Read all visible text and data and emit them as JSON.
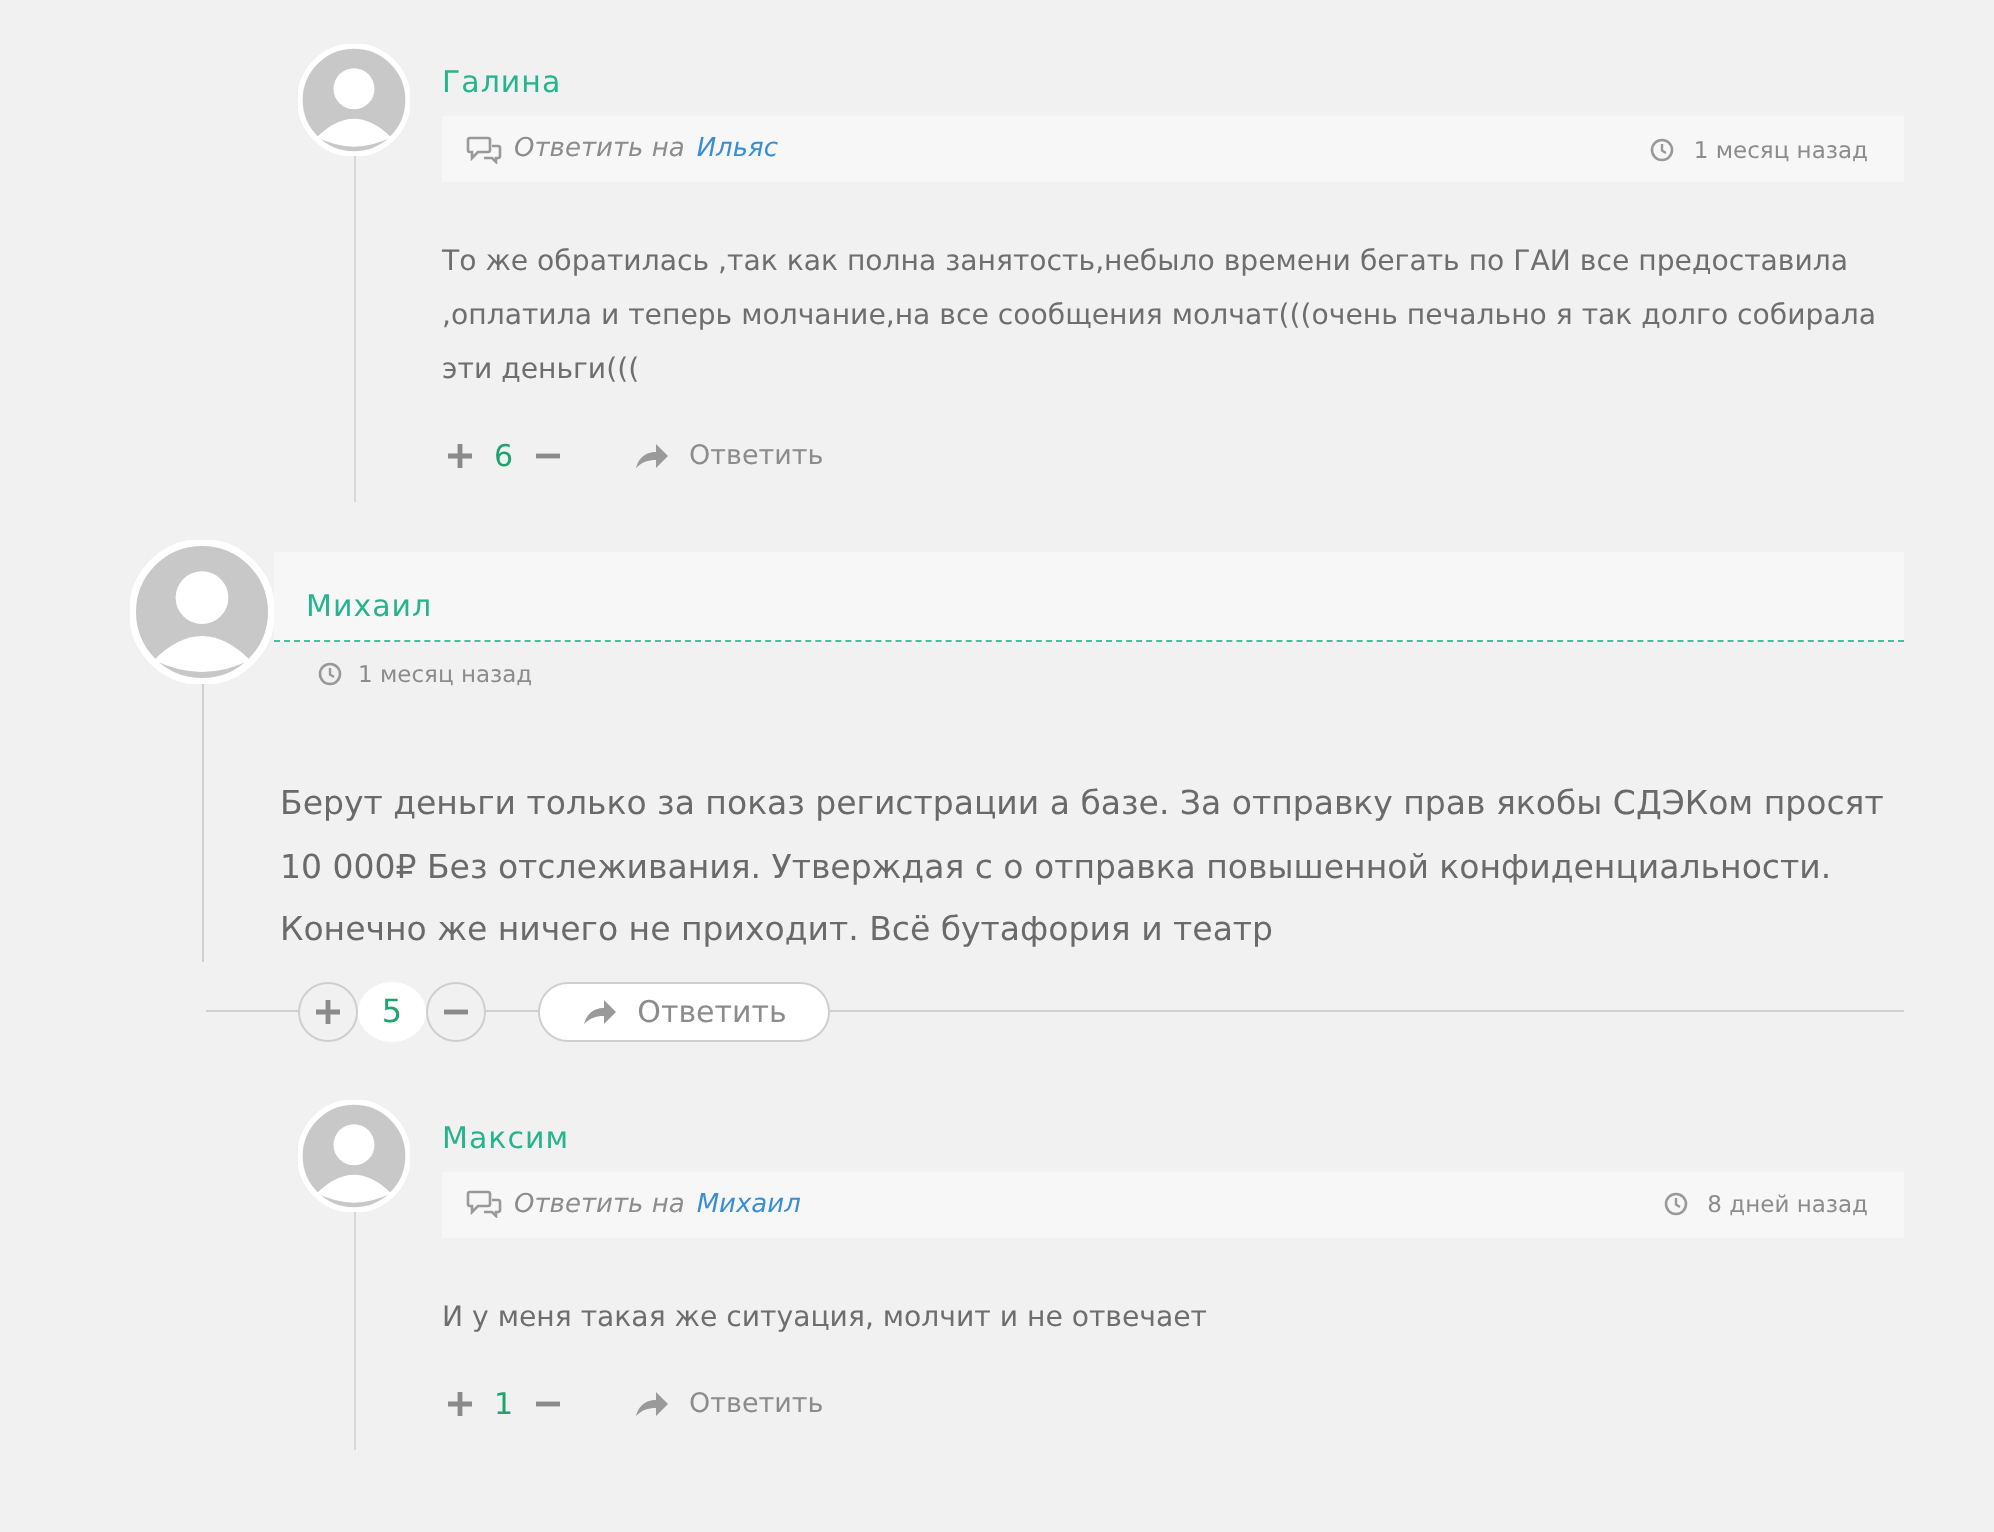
{
  "comments": [
    {
      "kind": "reply",
      "author": "Галина",
      "reply_label": "Ответить на",
      "reply_to": "Ильяс",
      "time": "1 месяц назад",
      "text": "То же обратилась ,так как полна занятость,небыло времени бегать по ГАИ все предоставила ,оплатила и теперь молчание,на все сообщения молчат(((очень печально я так долго собирала эти деньги(((",
      "votes": "6",
      "reply_button": "Ответить"
    },
    {
      "kind": "top",
      "author": "Михаил",
      "time": "1 месяц назад",
      "text": "Берут деньги только за показ регистрации а базе. За отправку прав якобы СДЭКом просят 10 000₽ Без отслеживания. Утверждая с о отправка повышенной конфиденциальности. Конечно же ничего не приходит. Всё бутафория и театр",
      "votes": "5",
      "reply_button": "Ответить"
    },
    {
      "kind": "reply",
      "author": "Максим",
      "reply_label": "Ответить на",
      "reply_to": "Михаил",
      "time": "8 дней назад",
      "text": "И у меня такая же ситуация, молчит и не отвечает",
      "votes": "1",
      "reply_button": "Ответить"
    }
  ]
}
